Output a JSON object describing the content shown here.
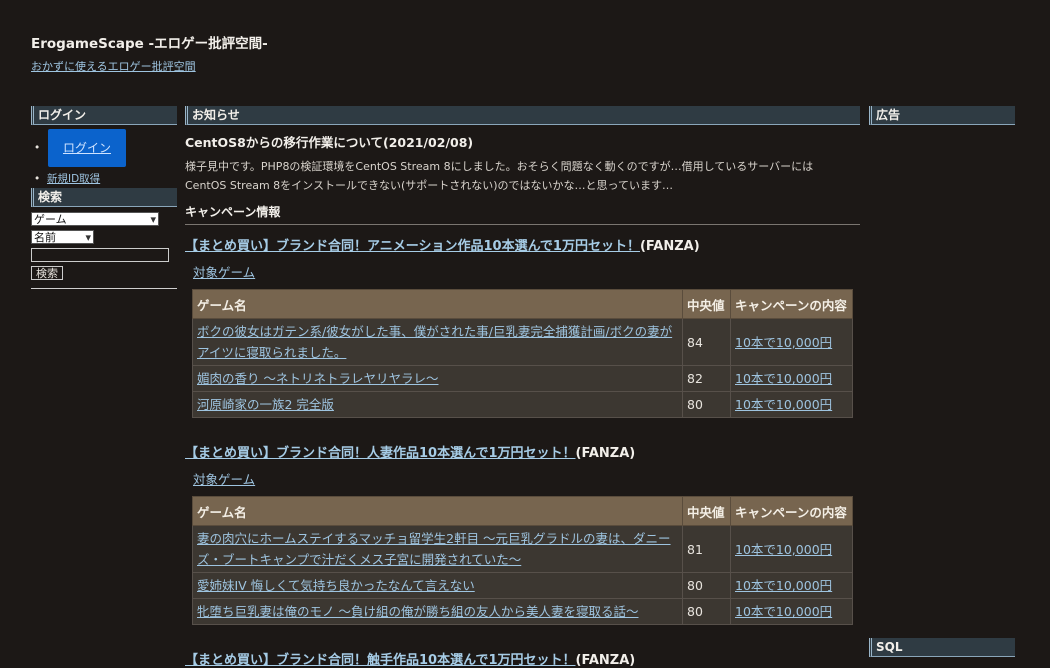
{
  "site": {
    "title": "ErogameScape -エロゲー批評空間-",
    "subtitle": "おかずに使えるエロゲー批評空間"
  },
  "sidebar": {
    "login_heading": "ログイン",
    "login_button": "ログイン",
    "register_link": "新規ID取得",
    "search_heading": "検索",
    "search_type_selected": "ゲーム",
    "search_field_selected": "名前",
    "search_input_value": "",
    "search_button": "検索"
  },
  "news": {
    "heading": "お知らせ",
    "title": "CentOS8からの移行作業について(2021/02/08)",
    "body": "様子見中です。PHP8の検証環境をCentOS Stream 8にしました。おそらく問題なく動くのですが…借用しているサーバーにはCentOS Stream 8をインストールできない(サポートされない)のではないかな…と思っています…"
  },
  "campaign_section": {
    "heading": "キャンペーン情報",
    "target_label": "対象ゲーム",
    "col_name": "ゲーム名",
    "col_median": "中央値",
    "col_content": "キャンペーンの内容"
  },
  "campaigns": [
    {
      "title": "【まとめ買い】ブランド合同！アニメーション作品10本選んで1万円セット！",
      "store": "(FANZA)",
      "rows": [
        {
          "name": "ボクの彼女はガテン系/彼女がした事、僕がされた事/巨乳妻完全捕獲計画/ボクの妻がアイツに寝取られました。",
          "median": "84",
          "content": "10本で10,000円"
        },
        {
          "name": "媚肉の香り ～ネトリネトラレヤリヤラレ～",
          "median": "82",
          "content": "10本で10,000円"
        },
        {
          "name": "河原崎家の一族2 完全版",
          "median": "80",
          "content": "10本で10,000円"
        }
      ]
    },
    {
      "title": "【まとめ買い】ブランド合同！人妻作品10本選んで1万円セット！",
      "store": "(FANZA)",
      "rows": [
        {
          "name": "妻の肉穴にホームステイするマッチョ留学生2軒目 ～元巨乳グラドルの妻は、ダニーズ・ブートキャンプで汁だくメス子宮に開発されていた～",
          "median": "81",
          "content": "10本で10,000円"
        },
        {
          "name": "愛姉妹IV 悔しくて気持ち良かったなんて言えない",
          "median": "80",
          "content": "10本で10,000円"
        },
        {
          "name": "牝堕ち巨乳妻は俺のモノ ～負け組の俺が勝ち組の友人から美人妻を寝取る話～",
          "median": "80",
          "content": "10本で10,000円"
        }
      ]
    },
    {
      "title": "【まとめ買い】ブランド合同！触手作品10本選んで1万円セット！",
      "store": "(FANZA)",
      "rows": []
    }
  ],
  "right": {
    "ad_heading": "広告",
    "sql_heading": "SQL"
  }
}
